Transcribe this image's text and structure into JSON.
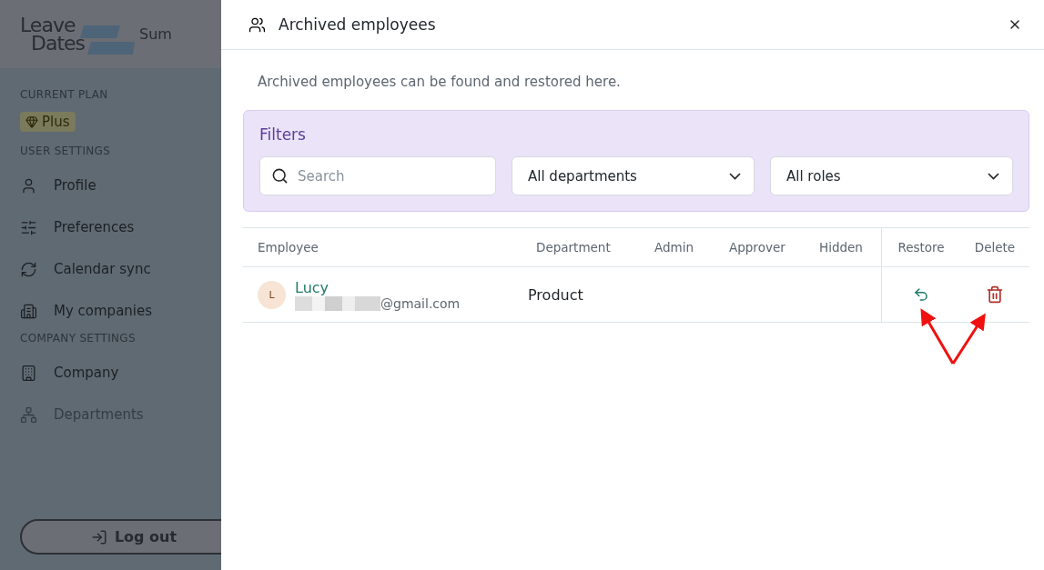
{
  "app": {
    "logo": [
      "Leave",
      "Dates"
    ],
    "header_tab": "Sum",
    "plan_label": "CURRENT PLAN",
    "plan_badge": "Plus",
    "sections": [
      {
        "title": "USER SETTINGS",
        "items": [
          {
            "label": "Profile",
            "disabled": false
          },
          {
            "label": "Preferences",
            "disabled": false
          },
          {
            "label": "Calendar sync",
            "disabled": false
          },
          {
            "label": "My companies",
            "disabled": false
          }
        ]
      },
      {
        "title": "COMPANY SETTINGS",
        "items": [
          {
            "label": "Company",
            "disabled": false
          },
          {
            "label": "Departments",
            "disabled": true
          }
        ]
      }
    ],
    "logout": "Log out"
  },
  "panel": {
    "title": "Archived employees",
    "description": "Archived employees can be found and restored here.",
    "filters": {
      "title": "Filters",
      "search": {
        "placeholder": "Search"
      },
      "selects": [
        "All departments",
        "All roles"
      ]
    },
    "table": {
      "columns": [
        "Employee",
        "Department",
        "Admin",
        "Approver",
        "Hidden",
        "Restore",
        "Delete"
      ],
      "rows": [
        {
          "initial": "L",
          "name": "Lucy",
          "email": "@gmail.com",
          "department": "Product"
        }
      ]
    }
  }
}
